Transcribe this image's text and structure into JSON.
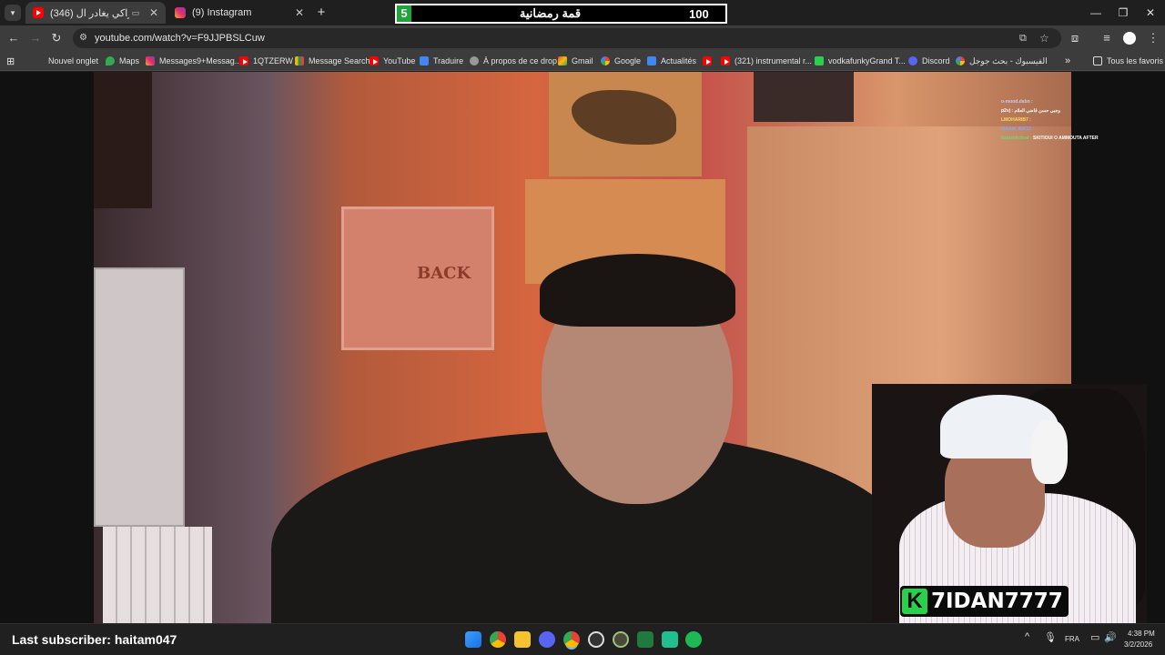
{
  "browser": {
    "tabs": [
      {
        "title": "(346) رسميا ركراكي يغادر ال...",
        "icon": "youtube-icon",
        "active": true
      },
      {
        "title": "(9) Instagram",
        "icon": "instagram-icon",
        "active": false
      }
    ],
    "url": "youtube.com/watch?v=F9JJPBSLCuw",
    "bookmarks": [
      {
        "label": "Nouvel onglet",
        "icon": "apps-icon"
      },
      {
        "label": "Maps",
        "icon": "maps-icon"
      },
      {
        "label": "Messages9+Messag...",
        "icon": "instagram-icon"
      },
      {
        "label": "1QTZERW",
        "icon": "youtube-icon"
      },
      {
        "label": "Message Search",
        "icon": "chart-icon"
      },
      {
        "label": "YouTube",
        "icon": "youtube-icon"
      },
      {
        "label": "Traduire",
        "icon": "translate-icon"
      },
      {
        "label": "À propos de ce drop",
        "icon": "globe-icon"
      },
      {
        "label": "Gmail",
        "icon": "gmail-icon"
      },
      {
        "label": "Google",
        "icon": "google-icon"
      },
      {
        "label": "Actualités",
        "icon": "news-icon"
      },
      {
        "label": "",
        "icon": "youtube-icon"
      },
      {
        "label": "(321) instrumental r...",
        "icon": "youtube-icon"
      },
      {
        "label": "vodkafunkyGrand T...",
        "icon": "kick-icon"
      },
      {
        "label": "Discord",
        "icon": "discord-icon"
      },
      {
        "label": "الفيسبوك - بحث جوجل",
        "icon": "google-icon"
      }
    ],
    "all_bookmarks": "Tous les favoris"
  },
  "overlay": {
    "ramadan_number": "5",
    "ramadan_title": "قمة رمضانية",
    "ramadan_score": "100",
    "chat": [
      {
        "user": "o-mood.dsbn :",
        "msg": "",
        "user_color": "#c9c9ff"
      },
      {
        "user": "",
        "msg": "وجبي حسن قاضي العلام : p2vj",
        "user_color": "#ffffff"
      },
      {
        "user": "LMOHARIB7 :",
        "msg": "",
        "user_color": "#ffd966"
      },
      {
        "user": "ISSAM_IBK13 :",
        "msg": "",
        "user_color": "#7aa7ff"
      },
      {
        "user": "ItsjustAchraf :",
        "msg": "SKITIOUI O AMMOUTA AFTER",
        "user_color": "#5fe07a"
      }
    ],
    "video_wall_sign": "BACK",
    "streamer_name": "7IDAN7777",
    "last_subscriber": "Last subscriber: haitam047"
  },
  "taskbar": {
    "language": "FRA",
    "time": "4:38 PM",
    "date": "3/2/2026"
  }
}
